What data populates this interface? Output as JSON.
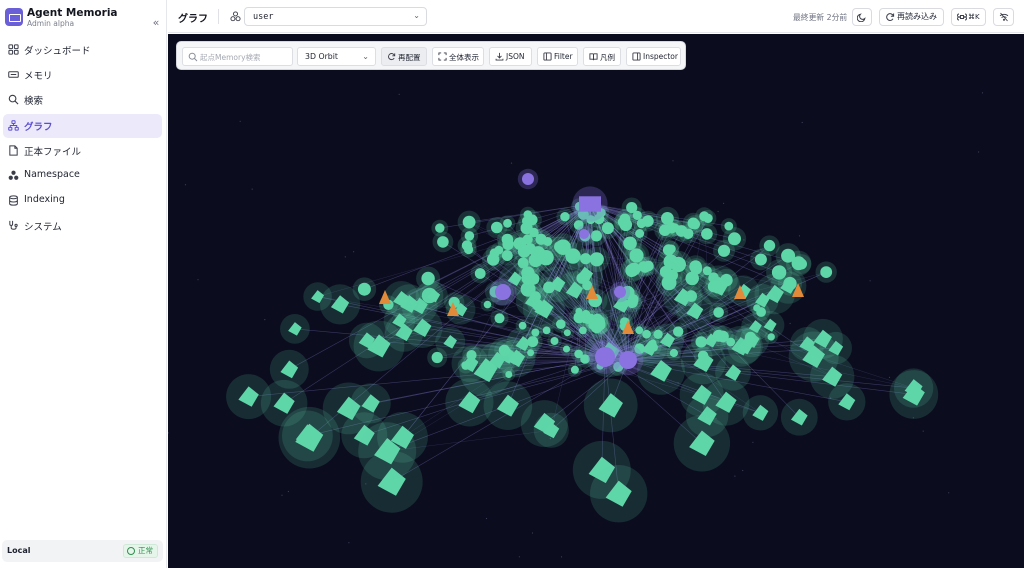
{
  "brand": {
    "title": "Agent Memoria",
    "subtitle": "Admin alpha",
    "collapse_glyph": "«"
  },
  "sidebar": {
    "items": [
      {
        "label": "ダッシュボード",
        "icon": "dashboard-icon",
        "active": false
      },
      {
        "label": "メモリ",
        "icon": "memory-icon",
        "active": false
      },
      {
        "label": "検索",
        "icon": "search-icon",
        "active": false
      },
      {
        "label": "グラフ",
        "icon": "graph-icon",
        "active": true
      },
      {
        "label": "正本ファイル",
        "icon": "file-icon",
        "active": false
      },
      {
        "label": "Namespace",
        "icon": "namespace-icon",
        "active": false
      },
      {
        "label": "Indexing",
        "icon": "database-icon",
        "active": false
      },
      {
        "label": "システム",
        "icon": "stethoscope-icon",
        "active": false
      }
    ],
    "footer": {
      "env": "Local",
      "status": "正常"
    }
  },
  "topbar": {
    "title": "グラフ",
    "namespace": "user",
    "updated": "最終更新 2分前",
    "reload_label": "再読み込み",
    "shortcut_label": "⌘K"
  },
  "toolbar": {
    "search_placeholder": "起点Memory検索",
    "mode": "3D Orbit",
    "buttons": [
      "再配置",
      "全体表示",
      "JSON",
      "Filter",
      "凡例",
      "Inspector"
    ]
  },
  "colors": {
    "accent": "#6a5fd6",
    "canvas_bg": "#0b0c1e",
    "memory_node": "#5fd6a8",
    "hub_node": "#8a72e0",
    "entity_node": "#e08a3a",
    "edge": "#8f86e0"
  }
}
